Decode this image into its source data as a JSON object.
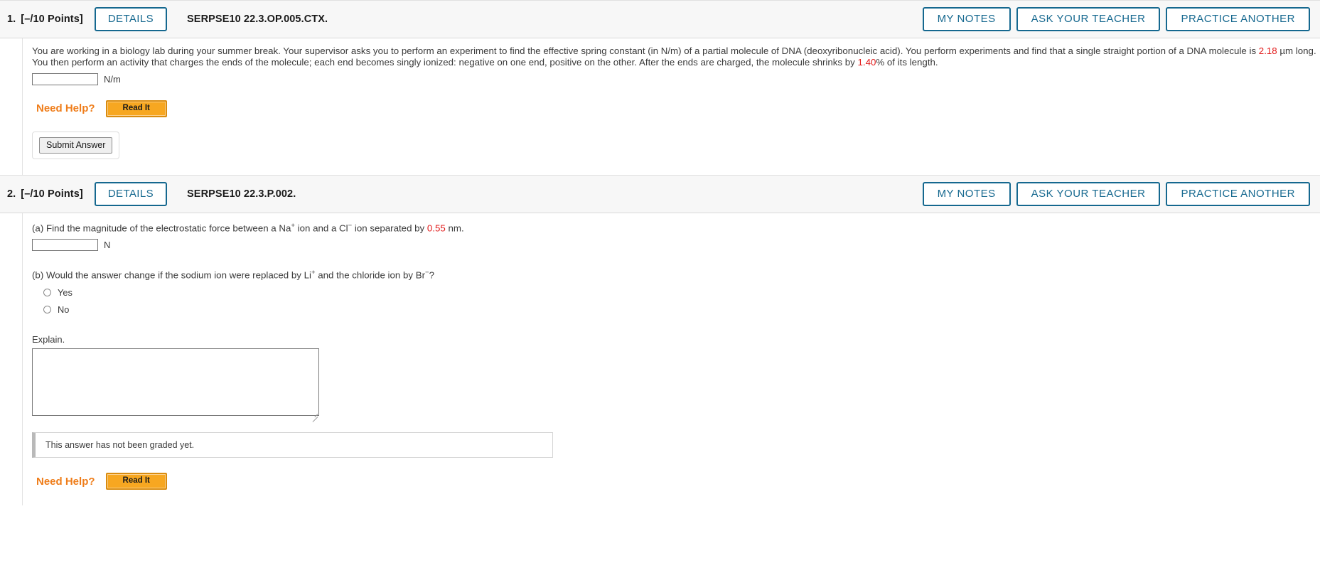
{
  "questions": [
    {
      "number": "1.",
      "points": "[–/10 Points]",
      "details_label": "DETAILS",
      "code": "SERPSE10 22.3.OP.005.CTX.",
      "actions": [
        "MY NOTES",
        "ASK YOUR TEACHER",
        "PRACTICE ANOTHER"
      ],
      "prompt": {
        "seg1": "You are working in a biology lab during your summer break. Your supervisor asks you to perform an experiment to find the effective spring constant (in N/m) of a partial molecule of DNA (deoxyribonucleic acid). You perform experiments and find that a single straight portion of a DNA molecule is ",
        "value1": "2.18",
        "seg2": " µm long. You then perform an activity that charges the ends of the molecule; each end becomes singly ionized: negative on one end, positive on the other. After the ends are charged, the molecule shrinks by ",
        "value2": "1.40",
        "seg3": "% of its length."
      },
      "answer_value": "",
      "answer_unit": "N/m",
      "need_help_label": "Need Help?",
      "read_it_label": "Read It",
      "submit_label": "Submit Answer"
    },
    {
      "number": "2.",
      "points": "[–/10 Points]",
      "details_label": "DETAILS",
      "code": "SERPSE10 22.3.P.002.",
      "actions": [
        "MY NOTES",
        "ASK YOUR TEACHER",
        "PRACTICE ANOTHER"
      ],
      "part_a": {
        "seg1": "(a) Find the magnitude of the electrostatic force between a Na",
        "sup1": "+",
        "seg2": " ion and a Cl",
        "sup2": "−",
        "seg3": " ion separated by ",
        "value": "0.55",
        "seg4": " nm.",
        "answer_value": "",
        "answer_unit": "N"
      },
      "part_b": {
        "seg1": "(b) Would the answer change if the sodium ion were replaced by Li",
        "sup1": "+",
        "seg2": " and the chloride ion by Br",
        "sup2": "−",
        "seg3": "?",
        "options": [
          "Yes",
          "No"
        ]
      },
      "explain_label": "Explain.",
      "explain_value": "",
      "not_graded_text": "This answer has not been graded yet.",
      "need_help_label": "Need Help?",
      "read_it_label": "Read It"
    }
  ],
  "colors": {
    "accent_blue": "#15688f",
    "value_red": "#e21b1b",
    "help_orange": "#ef7d1a",
    "read_it_bg": "#f7a721"
  }
}
